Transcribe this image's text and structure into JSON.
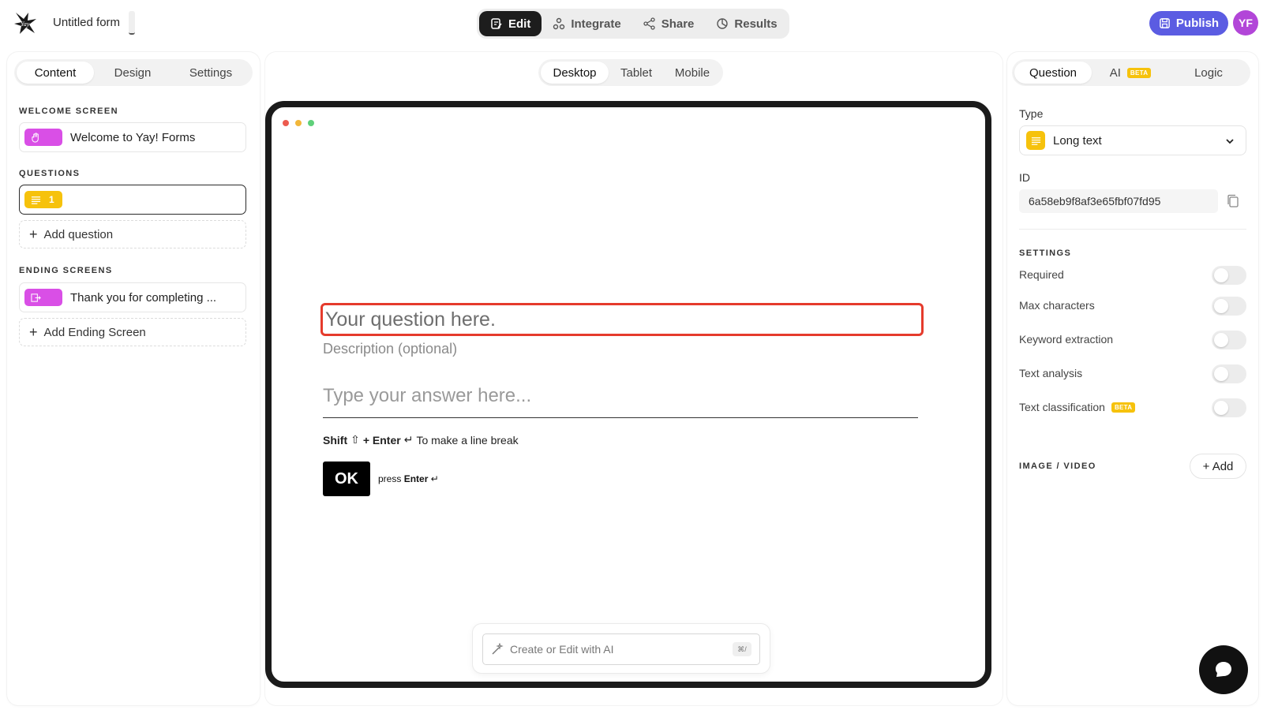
{
  "header": {
    "form_title": "Untitled form",
    "mode_tabs": [
      {
        "label": "Edit",
        "icon": "edit-icon",
        "active": true
      },
      {
        "label": "Integrate",
        "icon": "integrate-icon",
        "active": false
      },
      {
        "label": "Share",
        "icon": "share-icon",
        "active": false
      },
      {
        "label": "Results",
        "icon": "results-icon",
        "active": false
      }
    ],
    "publish_label": "Publish",
    "avatar_initials": "YF"
  },
  "left": {
    "tabs": [
      "Content",
      "Design",
      "Settings"
    ],
    "active_tab": "Content",
    "welcome_label": "WELCOME SCREEN",
    "welcome_item": "Welcome to Yay! Forms",
    "questions_label": "QUESTIONS",
    "question_number": "1",
    "add_question": "Add question",
    "ending_label": "ENDING SCREENS",
    "ending_item": "Thank you for completing ...",
    "add_ending": "Add Ending Screen"
  },
  "center": {
    "device_tabs": [
      "Desktop",
      "Tablet",
      "Mobile"
    ],
    "active_device": "Desktop",
    "question_placeholder": "Your question here.",
    "description_placeholder": "Description (optional)",
    "answer_placeholder": "Type your answer here...",
    "hint_shift": "Shift",
    "hint_enter": "+ Enter",
    "hint_text": "To make a line break",
    "ok_label": "OK",
    "press_label": "press",
    "press_key": "Enter",
    "ai_placeholder": "Create or Edit with AI",
    "ai_shortcut": "⌘/"
  },
  "right": {
    "tabs": [
      "Question",
      "AI",
      "Logic"
    ],
    "ai_badge": "BETA",
    "active_tab": "Question",
    "type_label": "Type",
    "type_value": "Long text",
    "id_label": "ID",
    "id_value": "6a58eb9f8af3e65fbf07fd95",
    "settings_label": "SETTINGS",
    "settings": [
      {
        "label": "Required",
        "on": false
      },
      {
        "label": "Max characters",
        "on": false
      },
      {
        "label": "Keyword extraction",
        "on": false
      },
      {
        "label": "Text analysis",
        "on": false
      },
      {
        "label": "Text classification",
        "on": false,
        "badge": "BETA"
      }
    ],
    "media_label": "IMAGE / VIDEO",
    "add_media": "+ Add"
  },
  "colors": {
    "accent": "#5b5ce2",
    "avatar": "#b246d8",
    "welcome_chip": "#d94fe6",
    "question_chip": "#f6c20c",
    "ending_chip": "#d94fe6",
    "highlight": "#e53b2c"
  }
}
